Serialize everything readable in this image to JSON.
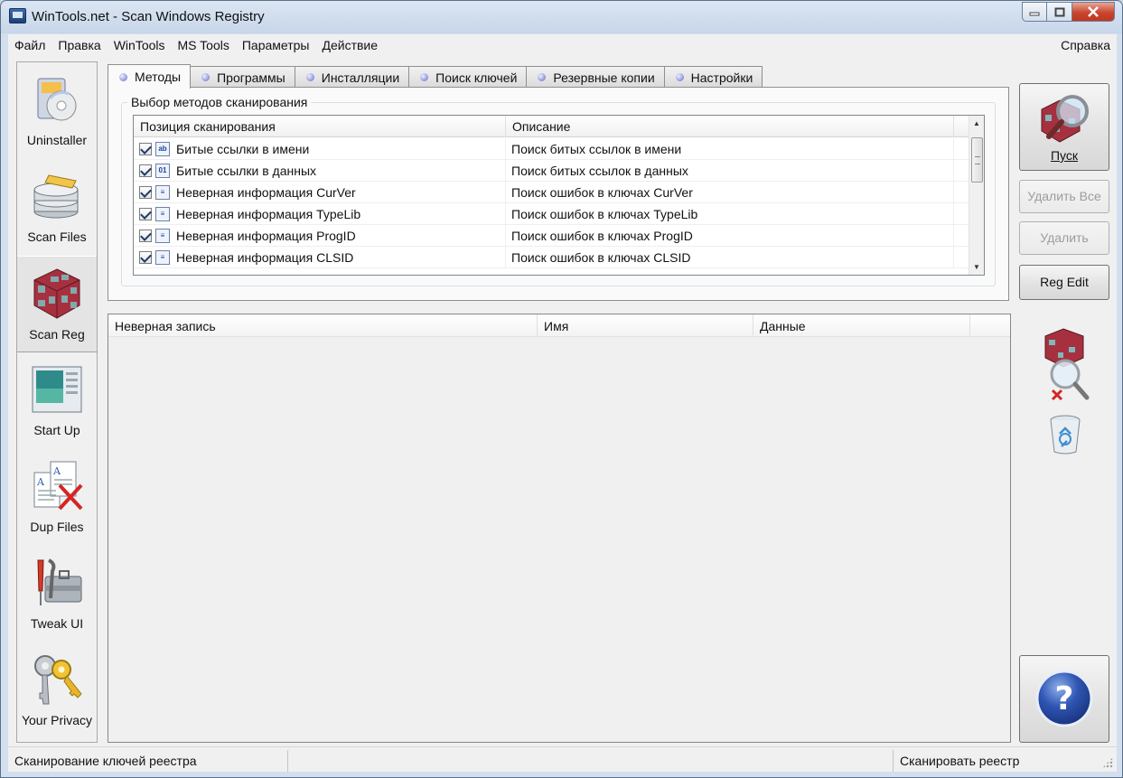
{
  "window": {
    "title": "WinTools.net - Scan Windows Registry"
  },
  "menu": {
    "items": [
      "Файл",
      "Правка",
      "WinTools",
      "MS Tools",
      "Параметры",
      "Действие"
    ],
    "help": "Справка"
  },
  "nav": {
    "items": [
      {
        "label": "Uninstaller",
        "icon": "uninstaller-icon"
      },
      {
        "label": "Scan Files",
        "icon": "scan-files-icon"
      },
      {
        "label": "Scan Reg",
        "icon": "scan-reg-icon",
        "active": true
      },
      {
        "label": "Start Up",
        "icon": "startup-icon"
      },
      {
        "label": "Dup Files",
        "icon": "dup-files-icon"
      },
      {
        "label": "Tweak UI",
        "icon": "tweak-ui-icon"
      },
      {
        "label": "Your Privacy",
        "icon": "privacy-keys-icon"
      }
    ]
  },
  "tabs": [
    "Методы",
    "Программы",
    "Инсталляции",
    "Поиск ключей",
    "Резервные копии",
    "Настройки"
  ],
  "methods": {
    "group_title": "Выбор методов сканирования",
    "columns": [
      "Позиция сканирования",
      "Описание"
    ],
    "rows": [
      {
        "name": "Битые ссылки в имени",
        "description": "Поиск битых ссылок в имени",
        "icon": "ab",
        "checked": true
      },
      {
        "name": "Битые ссылки в данных",
        "description": "Поиск битых ссылок в данных",
        "icon": "01",
        "checked": true
      },
      {
        "name": "Неверная информация CurVer",
        "description": "Поиск ошибок в ключах CurVer",
        "icon": "≡",
        "checked": true
      },
      {
        "name": "Неверная информация TypeLib",
        "description": "Поиск ошибок в ключах TypeLib",
        "icon": "≡",
        "checked": true
      },
      {
        "name": "Неверная информация ProgID",
        "description": "Поиск ошибок в ключах ProgID",
        "icon": "≡",
        "checked": true
      },
      {
        "name": "Неверная информация CLSID",
        "description": "Поиск ошибок в ключах CLSID",
        "icon": "≡",
        "checked": true
      }
    ]
  },
  "results": {
    "columns": [
      "Неверная запись",
      "Имя",
      "Данные"
    ]
  },
  "buttons": {
    "start": "Пуск",
    "delete_all": "Удалить Все",
    "delete": "Удалить",
    "reg_edit": "Reg Edit"
  },
  "status": {
    "left": "Сканирование ключей реестра",
    "right": "Сканировать реестр"
  },
  "colors": {
    "accent": "#3a5fb0",
    "window_frame": "#c7d6ea",
    "close_button": "#c9452d"
  }
}
